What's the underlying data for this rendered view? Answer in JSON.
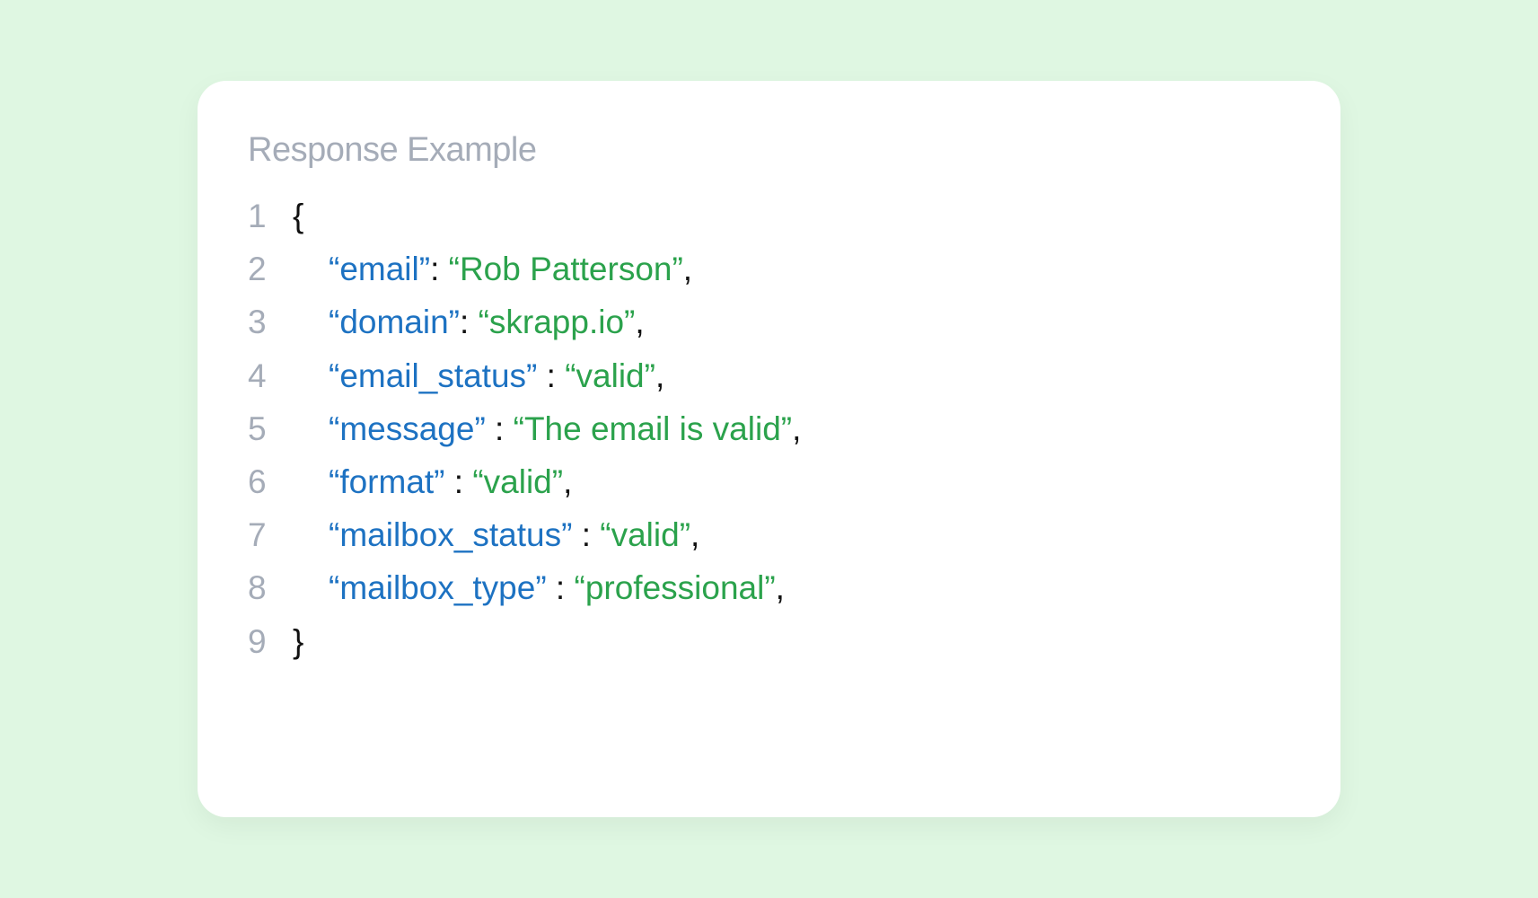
{
  "title": "Response Example",
  "lines": [
    {
      "num": "1",
      "type": "brace",
      "text": "{"
    },
    {
      "num": "2",
      "type": "kv",
      "key": "“email”",
      "colon": ": ",
      "value": "“Rob Patterson”",
      "comma": ","
    },
    {
      "num": "3",
      "type": "kv",
      "key": "“domain”",
      "colon": ": ",
      "value": "“skrapp.io”",
      "comma": ","
    },
    {
      "num": "4",
      "type": "kv",
      "key": "“email_status”",
      "colon": " : ",
      "value": "“valid”",
      "comma": ","
    },
    {
      "num": "5",
      "type": "kv",
      "key": "“message”",
      "colon": " : ",
      "value": "“The email is valid”",
      "comma": ","
    },
    {
      "num": "6",
      "type": "kv",
      "key": "“format”",
      "colon": " : ",
      "value": "“valid”",
      "comma": ","
    },
    {
      "num": "7",
      "type": "kv",
      "key": "“mailbox_status”",
      "colon": " : ",
      "value": "“valid”",
      "comma": ","
    },
    {
      "num": "8",
      "type": "kv",
      "key": "“mailbox_type”",
      "colon": " : ",
      "value": "“professional”",
      "comma": ","
    },
    {
      "num": "9",
      "type": "brace",
      "text": "}"
    }
  ]
}
